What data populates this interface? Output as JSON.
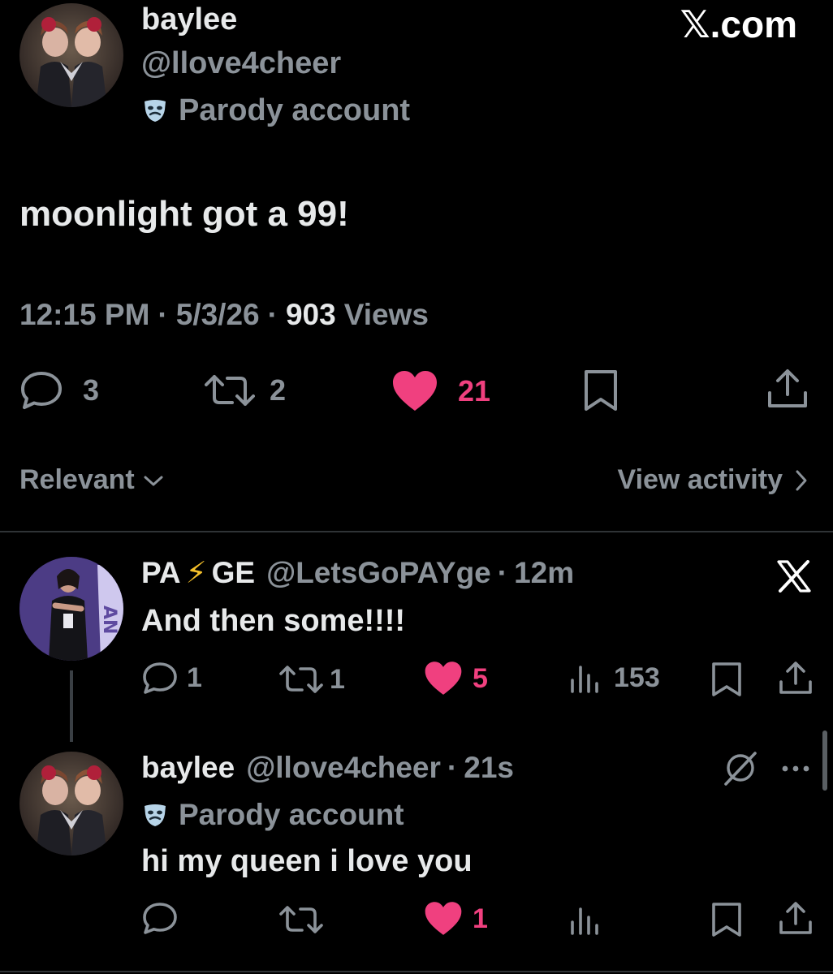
{
  "main_tweet": {
    "display_name": "baylee",
    "handle": "@llove4cheer",
    "parody_label": "Parody account",
    "text": "moonlight got a 99!",
    "time": "12:15 PM",
    "date": "5/3/26",
    "views_count": "903",
    "views_label": "Views",
    "replies": "3",
    "reposts": "2",
    "likes": "21"
  },
  "watermark": "𝕏.com",
  "filter": {
    "sort_label": "Relevant",
    "activity_label": "View activity"
  },
  "reply1": {
    "name_part1": "PA",
    "name_emoji": "⚡",
    "name_part2": "GE",
    "handle": "@LetsGoPAYge",
    "time": "12m",
    "text": "And then some!!!!",
    "replies": "1",
    "reposts": "1",
    "likes": "5",
    "views": "153"
  },
  "reply2": {
    "display_name": "baylee",
    "handle": "@llove4cheer",
    "time": "21s",
    "parody_label": "Parody account",
    "text": "hi my queen i love you",
    "likes": "1"
  },
  "colors": {
    "like_pink": "#f0407f",
    "muted": "#8b9299",
    "background": "#000000"
  },
  "icons": [
    "reply-icon",
    "repost-icon",
    "heart-icon",
    "bookmark-icon",
    "share-icon",
    "views-icon",
    "x-logo-icon",
    "grok-icon",
    "more-icon",
    "mask-icon",
    "chevron-down-icon",
    "chevron-right-icon"
  ]
}
